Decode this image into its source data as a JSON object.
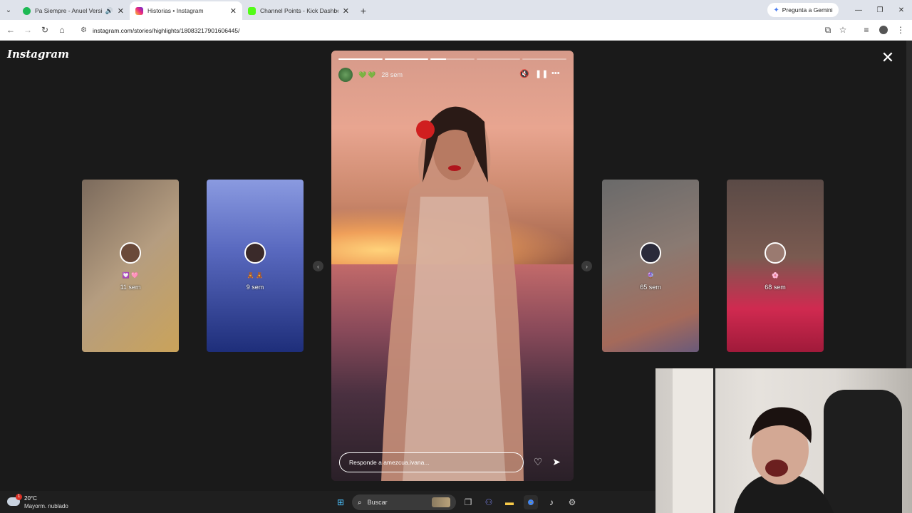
{
  "browser": {
    "tabs": [
      {
        "title": "Pa Siempre - Anuel Version",
        "active": false,
        "favicon_color": "#1db954",
        "has_speaker": true
      },
      {
        "title": "Historias • Instagram",
        "active": true,
        "favicon_color": "#d6249f",
        "has_speaker": false
      },
      {
        "title": "Channel Points - Kick Dashboar",
        "active": false,
        "favicon_color": "#53fc18",
        "has_speaker": false
      }
    ],
    "gemini_label": "Pregunta a Gemini",
    "url": "instagram.com/stories/highlights/18083217901606445/"
  },
  "instagram": {
    "logo": "Instagram",
    "side_stories": [
      {
        "time": "11 sem",
        "emoji": "💟 🩷",
        "bg": [
          "#6b5a50",
          "#c7a87e"
        ]
      },
      {
        "time": "9 sem",
        "emoji": "🧸 🧸",
        "bg": [
          "#5a6ec0",
          "#2a3a8a"
        ]
      },
      {
        "time": "65 sem",
        "emoji": "🔮",
        "bg": [
          "#5a5a5a",
          "#b07060"
        ]
      },
      {
        "time": "68 sem",
        "emoji": "🌸",
        "bg": [
          "#5a4a46",
          "#d02a50"
        ]
      }
    ],
    "story": {
      "time_ago": "28 sem",
      "hearts": "💚💚",
      "reply_placeholder": "Responde a amezcua.ivana...",
      "progress": [
        1.0,
        1.0,
        0.35,
        0.0,
        0.0
      ]
    }
  },
  "taskbar": {
    "weather_temp": "20°C",
    "weather_desc": "Mayorm. nublado",
    "weather_badge": "1",
    "search_placeholder": "Buscar"
  }
}
